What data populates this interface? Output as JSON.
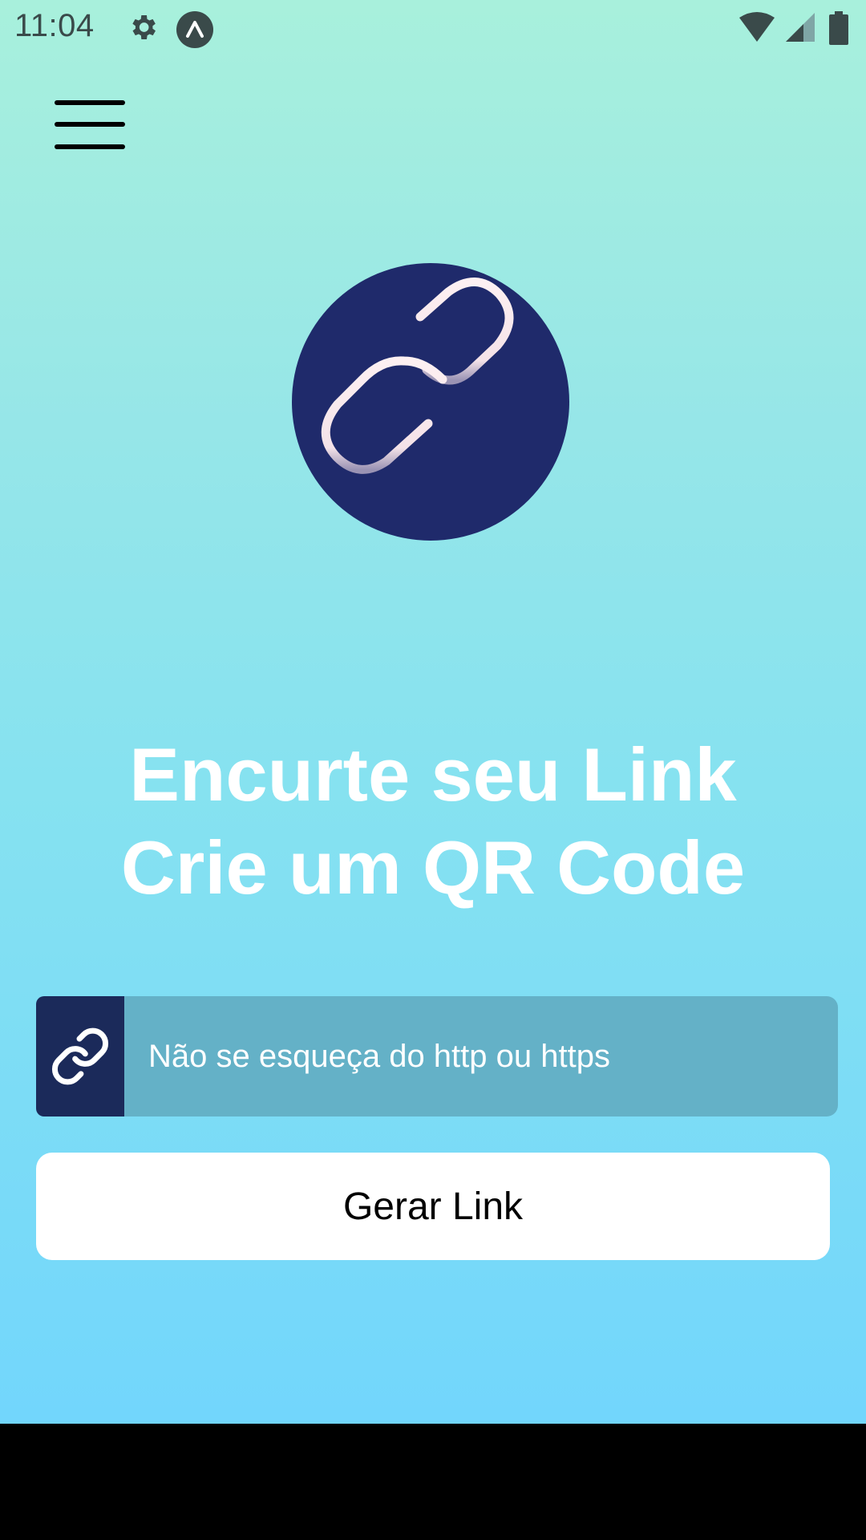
{
  "status_bar": {
    "time": "11:04",
    "icons": [
      "gear-icon",
      "expo-icon",
      "wifi-icon",
      "signal-icon",
      "battery-icon"
    ]
  },
  "header": {
    "menu_icon": "hamburger-menu-icon"
  },
  "logo": {
    "icon": "link-chain-logo",
    "background_color": "#1f2a6b",
    "chain_color": "#fdf0f2"
  },
  "hero": {
    "line1": "Encurte seu Link",
    "line2": "Crie um QR Code"
  },
  "form": {
    "input_icon": "link-icon",
    "input_value": "",
    "input_placeholder": "Não se esqueça do http ou https",
    "button_label": "Gerar Link"
  },
  "colors": {
    "gradient_top": "#a8f0dc",
    "gradient_bottom": "#72d6fc",
    "icon_box": "#1b2a5a",
    "input_bg": "#64b1c7",
    "button_bg": "#ffffff"
  }
}
